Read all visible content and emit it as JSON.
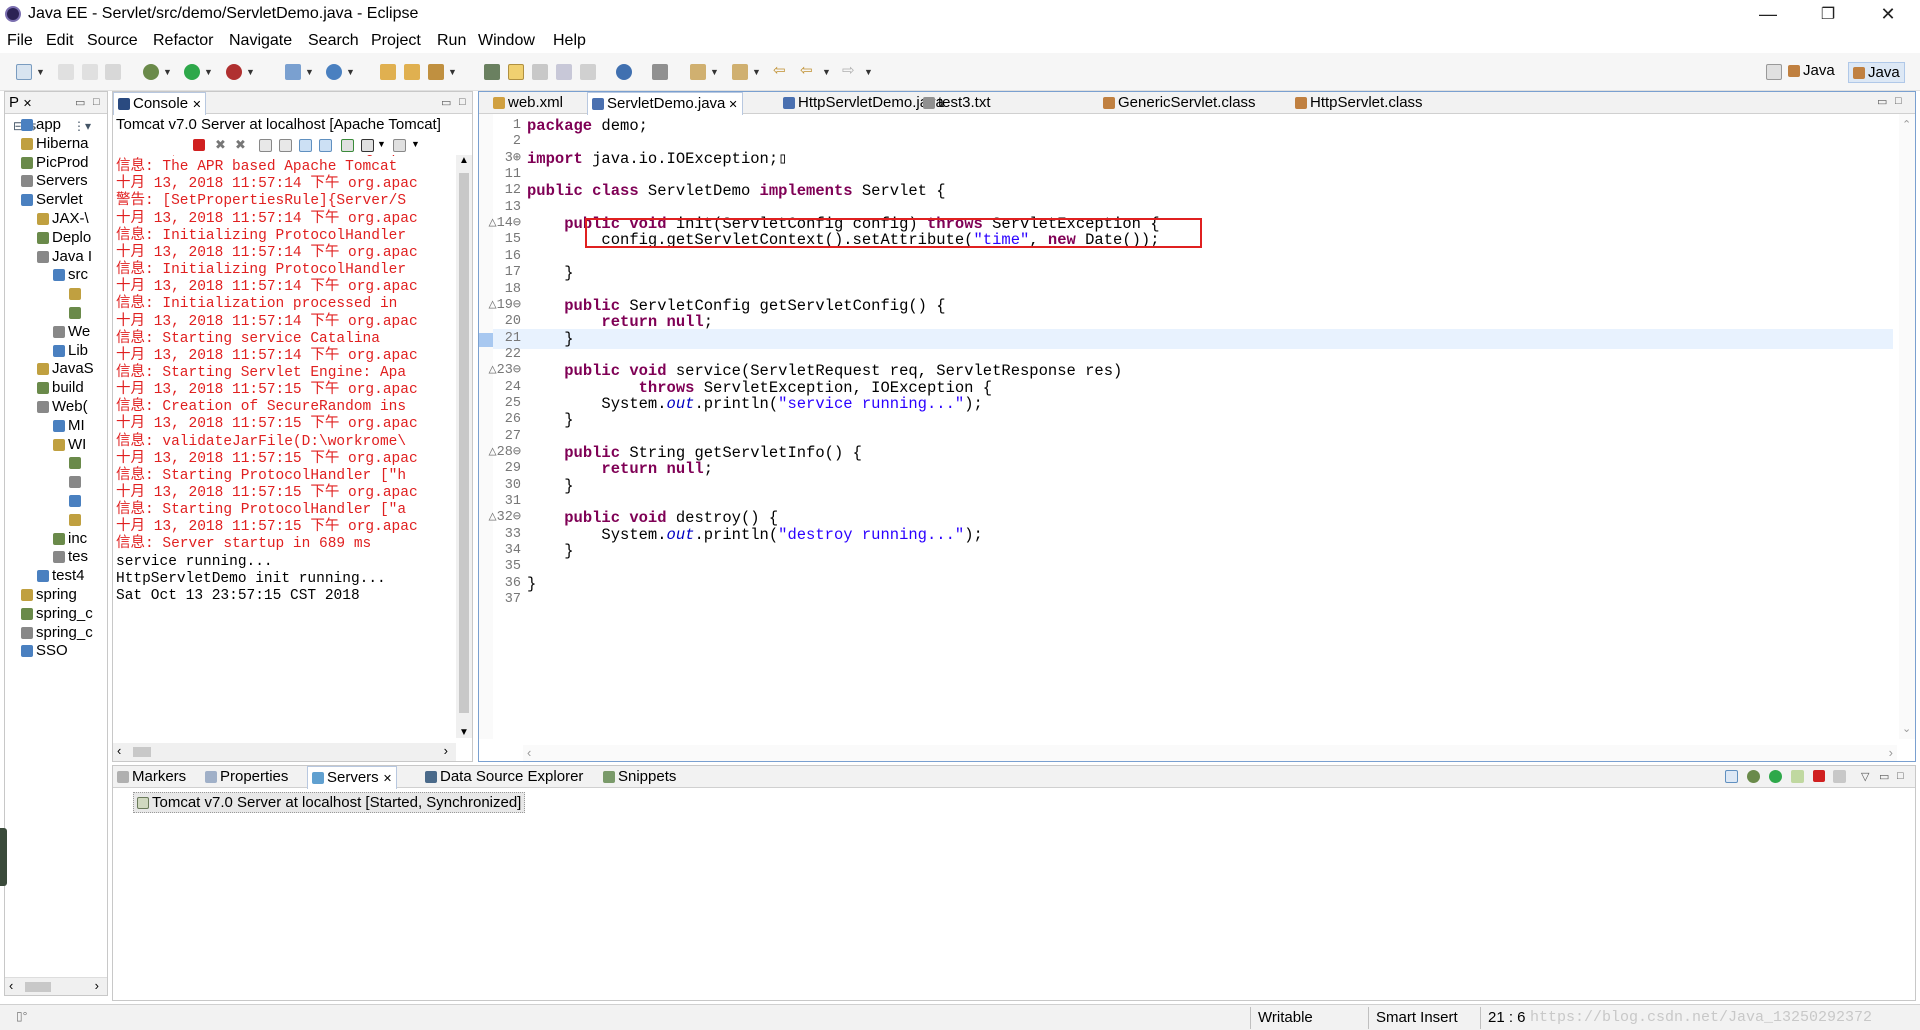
{
  "window": {
    "title": "Java EE - Servlet/src/demo/ServletDemo.java - Eclipse"
  },
  "menu": [
    "File",
    "Edit",
    "Source",
    "Refactor",
    "Navigate",
    "Search",
    "Project",
    "Run",
    "Window",
    "Help"
  ],
  "perspectives": [
    "Java",
    "Java"
  ],
  "explorer": {
    "tab": "P",
    "items": [
      {
        "label": "app",
        "indent": 0
      },
      {
        "label": "Hiberna",
        "indent": 0
      },
      {
        "label": "PicProd",
        "indent": 0
      },
      {
        "label": "Servers",
        "indent": 0
      },
      {
        "label": "Servlet",
        "indent": 0
      },
      {
        "label": "JAX-\\",
        "indent": 1
      },
      {
        "label": "Deplo",
        "indent": 1
      },
      {
        "label": "Java I",
        "indent": 1
      },
      {
        "label": "src",
        "indent": 2
      },
      {
        "label": "",
        "indent": 3
      },
      {
        "label": "",
        "indent": 3
      },
      {
        "label": "We",
        "indent": 2
      },
      {
        "label": "Lib",
        "indent": 2
      },
      {
        "label": "JavaS",
        "indent": 1
      },
      {
        "label": "build",
        "indent": 1
      },
      {
        "label": "Web(",
        "indent": 1
      },
      {
        "label": "MI",
        "indent": 2
      },
      {
        "label": "WI",
        "indent": 2
      },
      {
        "label": "",
        "indent": 3
      },
      {
        "label": "",
        "indent": 3
      },
      {
        "label": "",
        "indent": 3
      },
      {
        "label": "",
        "indent": 3
      },
      {
        "label": "inc",
        "indent": 2
      },
      {
        "label": "tes",
        "indent": 2
      },
      {
        "label": "test4",
        "indent": 1
      },
      {
        "label": "spring",
        "indent": 0
      },
      {
        "label": "spring_c",
        "indent": 0
      },
      {
        "label": "spring_c",
        "indent": 0
      },
      {
        "label": "SSO",
        "indent": 0
      }
    ]
  },
  "console": {
    "tab": "Console",
    "header": "Tomcat v7.0 Server at localhost [Apache Tomcat]",
    "lines": [
      {
        "text": "十月 13, 2018 11:57:14 下午 org.apac",
        "red": true
      },
      {
        "text": "信息: The APR based Apache Tomcat",
        "red": true
      },
      {
        "text": "十月 13, 2018 11:57:14 下午 org.apac",
        "red": true
      },
      {
        "text": "警告: [SetPropertiesRule]{Server/S",
        "red": true
      },
      {
        "text": "十月 13, 2018 11:57:14 下午 org.apac",
        "red": true
      },
      {
        "text": "信息: Initializing ProtocolHandler",
        "red": true
      },
      {
        "text": "十月 13, 2018 11:57:14 下午 org.apac",
        "red": true
      },
      {
        "text": "信息: Initializing ProtocolHandler",
        "red": true
      },
      {
        "text": "十月 13, 2018 11:57:14 下午 org.apac",
        "red": true
      },
      {
        "text": "信息: Initialization processed in",
        "red": true
      },
      {
        "text": "十月 13, 2018 11:57:14 下午 org.apac",
        "red": true
      },
      {
        "text": "信息: Starting service Catalina",
        "red": true
      },
      {
        "text": "十月 13, 2018 11:57:14 下午 org.apac",
        "red": true
      },
      {
        "text": "信息: Starting Servlet Engine: Apa",
        "red": true
      },
      {
        "text": "十月 13, 2018 11:57:15 下午 org.apac",
        "red": true
      },
      {
        "text": "信息: Creation of SecureRandom ins",
        "red": true
      },
      {
        "text": "十月 13, 2018 11:57:15 下午 org.apac",
        "red": true
      },
      {
        "text": "信息: validateJarFile(D:\\workrome\\",
        "red": true
      },
      {
        "text": "十月 13, 2018 11:57:15 下午 org.apac",
        "red": true
      },
      {
        "text": "信息: Starting ProtocolHandler [\"h",
        "red": true
      },
      {
        "text": "十月 13, 2018 11:57:15 下午 org.apac",
        "red": true
      },
      {
        "text": "信息: Starting ProtocolHandler [\"a",
        "red": true
      },
      {
        "text": "十月 13, 2018 11:57:15 下午 org.apac",
        "red": true
      },
      {
        "text": "信息: Server startup in 689 ms",
        "red": true
      },
      {
        "text": "service running...",
        "red": false
      },
      {
        "text": "HttpServletDemo init running...",
        "red": false
      },
      {
        "text": "Sat Oct 13 23:57:15 CST 2018",
        "red": false
      }
    ]
  },
  "editor": {
    "tabs": [
      "web.xml",
      "ServletDemo.java",
      "HttpServletDemo.java",
      "test3.txt",
      "GenericServlet.class",
      "HttpServlet.class"
    ],
    "active_tab": 1,
    "lines": [
      {
        "n": "1",
        "html": "<span class='kw'>package</span> demo;"
      },
      {
        "n": "2",
        "html": ""
      },
      {
        "n": "3⊕",
        "html": "<span class='kw'>import</span> java.io.IOException;▯"
      },
      {
        "n": "11",
        "html": ""
      },
      {
        "n": "12",
        "html": "<span class='kw'>public class</span> ServletDemo <span class='kw'>implements</span> Servlet {"
      },
      {
        "n": "13",
        "html": ""
      },
      {
        "n": "△14⊖",
        "html": "    <span class='kw'>public void</span> init(ServletConfig config) <span class='kw'>throws</span> ServletException {"
      },
      {
        "n": "15",
        "html": "        config.getServletContext().setAttribute(<span class='str'>\"time\"</span>, <span class='kw'>new</span> Date());"
      },
      {
        "n": "16",
        "html": ""
      },
      {
        "n": "17",
        "html": "    }"
      },
      {
        "n": "18",
        "html": ""
      },
      {
        "n": "△19⊖",
        "html": "    <span class='kw'>public</span> ServletConfig getServletConfig() {"
      },
      {
        "n": "20",
        "html": "        <span class='kw'>return null</span>;"
      },
      {
        "n": "21",
        "html": "    }"
      },
      {
        "n": "22",
        "html": ""
      },
      {
        "n": "△23⊖",
        "html": "    <span class='kw'>public void</span> service(ServletRequest req, ServletResponse res)"
      },
      {
        "n": "24",
        "html": "            <span class='kw'>throws</span> ServletException, IOException {"
      },
      {
        "n": "25",
        "html": "        System.<span class='it'>out</span>.println(<span class='str'>\"service running...\"</span>);"
      },
      {
        "n": "26",
        "html": "    }"
      },
      {
        "n": "27",
        "html": ""
      },
      {
        "n": "△28⊖",
        "html": "    <span class='kw'>public</span> String getServletInfo() {"
      },
      {
        "n": "29",
        "html": "        <span class='kw'>return null</span>;"
      },
      {
        "n": "30",
        "html": "    }"
      },
      {
        "n": "31",
        "html": ""
      },
      {
        "n": "△32⊖",
        "html": "    <span class='kw'>public void</span> destroy() {"
      },
      {
        "n": "33",
        "html": "        System.<span class='it'>out</span>.println(<span class='str'>\"destroy running...\"</span>);"
      },
      {
        "n": "34",
        "html": "    }"
      },
      {
        "n": "35",
        "html": ""
      },
      {
        "n": "36",
        "html": "}"
      },
      {
        "n": "37",
        "html": ""
      }
    ]
  },
  "bottom": {
    "tabs": [
      "Markers",
      "Properties",
      "Servers",
      "Data Source Explorer",
      "Snippets"
    ],
    "server_entry": "Tomcat v7.0 Server at localhost  [Started, Synchronized]"
  },
  "status": {
    "writable": "Writable",
    "insert": "Smart Insert",
    "position": "21 : 6",
    "watermark": "https://blog.csdn.net/Java_13250292372"
  },
  "colors": {
    "keyword": "#7f0055",
    "string": "#2a00ff",
    "console_red": "#e02020",
    "highlight_box": "#e02020"
  }
}
